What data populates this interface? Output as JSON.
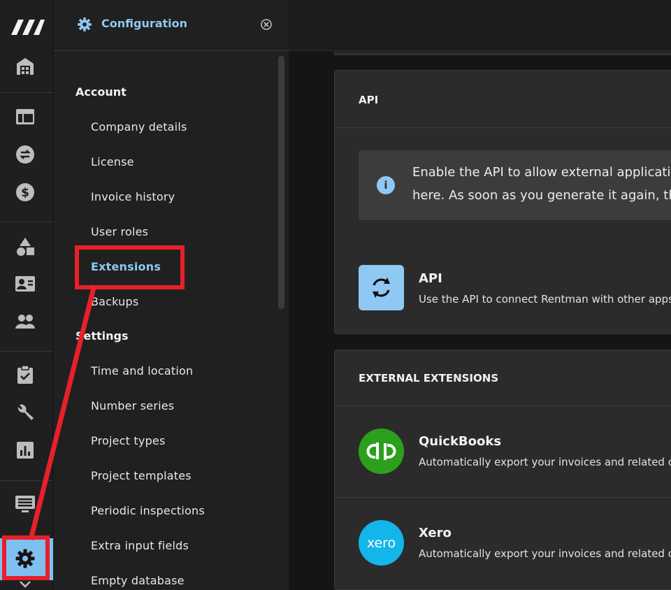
{
  "rail": {
    "icons": [
      "logo-icon",
      "warehouse-icon",
      "table-icon",
      "transfer-icon",
      "dollar-icon",
      "shapes-icon",
      "contact-card-icon",
      "people-icon",
      "clipboard-check-icon",
      "wrench-icon",
      "chart-icon",
      "display-icon",
      "gear-icon",
      "chevron-down-icon"
    ]
  },
  "panel": {
    "title": "Configuration",
    "sections": [
      {
        "title": "Account",
        "items": [
          "Company details",
          "License",
          "Invoice history",
          "User roles",
          "Extensions",
          "Backups"
        ]
      },
      {
        "title": "Settings",
        "items": [
          "Time and location",
          "Number series",
          "Project types",
          "Project templates",
          "Periodic inspections",
          "Extra input fields",
          "Empty database"
        ]
      }
    ],
    "active_item": "Extensions"
  },
  "main": {
    "api_card": {
      "title": "API",
      "info_line1": "Enable the API to allow external applicatio",
      "info_line2": "here. As soon as you generate it again, the",
      "item_name": "API",
      "item_desc": "Use the API to connect Rentman with other apps a"
    },
    "ext_card": {
      "title": "EXTERNAL EXTENSIONS",
      "items": [
        {
          "name": "QuickBooks",
          "desc": "Automatically export your invoices and related co",
          "logo_text": "qb"
        },
        {
          "name": "Xero",
          "desc": "Automatically export your invoices and related co",
          "logo_text": "xero"
        }
      ]
    }
  },
  "colors": {
    "accent": "#8fc8f2",
    "annotation": "#e8202a",
    "quickbooks": "#2ca01c",
    "xero": "#13b5ea"
  }
}
